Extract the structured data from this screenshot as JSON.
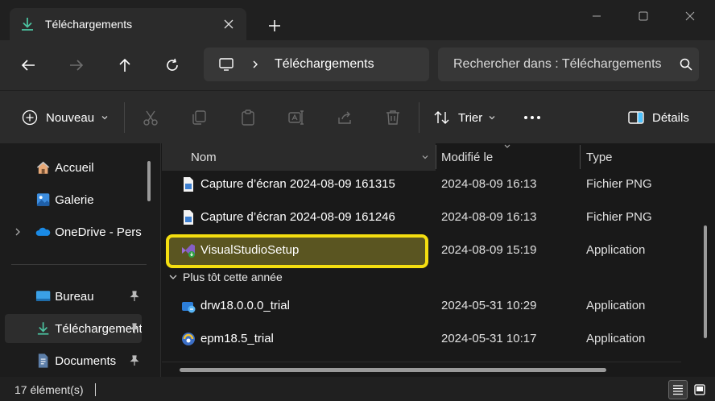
{
  "tab": {
    "title": "Téléchargements",
    "icon": "download-icon"
  },
  "window": {
    "minimize_icon": "minimize-icon",
    "maximize_icon": "maximize-icon",
    "close_icon": "close-icon"
  },
  "address": {
    "crumb": "Téléchargements",
    "search_placeholder": "Rechercher dans : Téléchargements"
  },
  "toolbar": {
    "new_label": "Nouveau",
    "sort_label": "Trier",
    "details_label": "Détails"
  },
  "sidebar": {
    "items": [
      {
        "label": "Accueil",
        "icon": "home-icon"
      },
      {
        "label": "Galerie",
        "icon": "gallery-icon"
      },
      {
        "label": "OneDrive - Personnel",
        "icon": "onedrive-icon"
      },
      {
        "label": "Bureau",
        "icon": "desktop-icon"
      },
      {
        "label": "Téléchargements",
        "icon": "download-icon"
      },
      {
        "label": "Documents",
        "icon": "documents-icon"
      }
    ]
  },
  "columns": {
    "name": "Nom",
    "modified": "Modifié le",
    "type": "Type"
  },
  "files": [
    {
      "name": "Capture d’écran 2024-08-09 161315",
      "date": "2024-08-09 16:13",
      "type": "Fichier PNG"
    },
    {
      "name": "Capture d’écran 2024-08-09 161246",
      "date": "2024-08-09 16:13",
      "type": "Fichier PNG"
    },
    {
      "name": "VisualStudioSetup",
      "date": "2024-08-09 15:19",
      "type": "Application"
    }
  ],
  "group": {
    "label": "Plus tôt cette année"
  },
  "files_earlier": [
    {
      "name": "drw18.0.0.0_trial",
      "date": "2024-05-31 10:29",
      "type": "Application"
    },
    {
      "name": "epm18.5_trial",
      "date": "2024-05-31 10:17",
      "type": "Application"
    }
  ],
  "status": {
    "count": "17 élément(s)"
  },
  "colors": {
    "highlight_border": "#f4de10",
    "accent": "#4cc2ff"
  }
}
